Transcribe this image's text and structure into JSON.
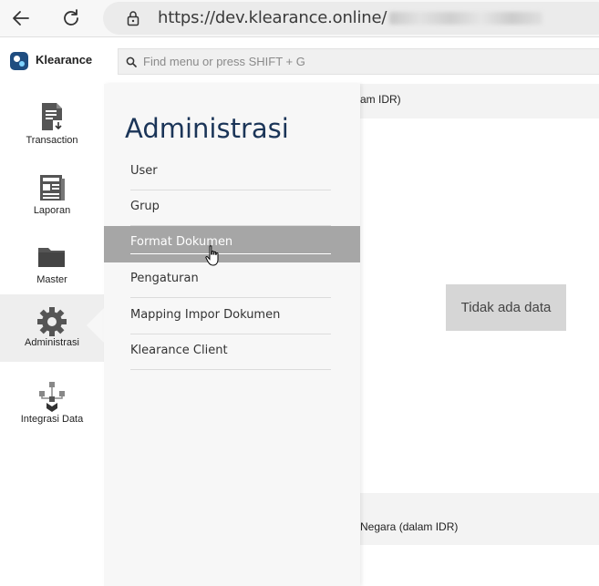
{
  "browser": {
    "url": "https://dev.klearance.online/"
  },
  "app": {
    "name": "Klearance",
    "search_placeholder": "Find menu or press SHIFT + G"
  },
  "sidebar": {
    "items": [
      {
        "label": "Transaction",
        "icon": "document-download-icon"
      },
      {
        "label": "Laporan",
        "icon": "newspaper-icon"
      },
      {
        "label": "Master",
        "icon": "folder-icon"
      },
      {
        "label": "Administrasi",
        "icon": "gear-icon",
        "active": true
      },
      {
        "label": "Integrasi Data",
        "icon": "network-icon"
      }
    ]
  },
  "flyout": {
    "title": "Administrasi",
    "items": [
      {
        "label": "User"
      },
      {
        "label": "Grup"
      },
      {
        "label": "Format Dokumen",
        "hovered": true
      },
      {
        "label": "Pengaturan"
      },
      {
        "label": "Mapping Impor Dokumen"
      },
      {
        "label": "Klearance Client"
      }
    ]
  },
  "content": {
    "top_bar_text": "am IDR)",
    "no_data": "Tidak ada data",
    "bottom_bar_text": "Negara (dalam IDR)"
  },
  "colors": {
    "brand": "#1f4d80",
    "title": "#1b3558",
    "hover": "#a6a6a6",
    "active_bg": "#eeeeee"
  }
}
